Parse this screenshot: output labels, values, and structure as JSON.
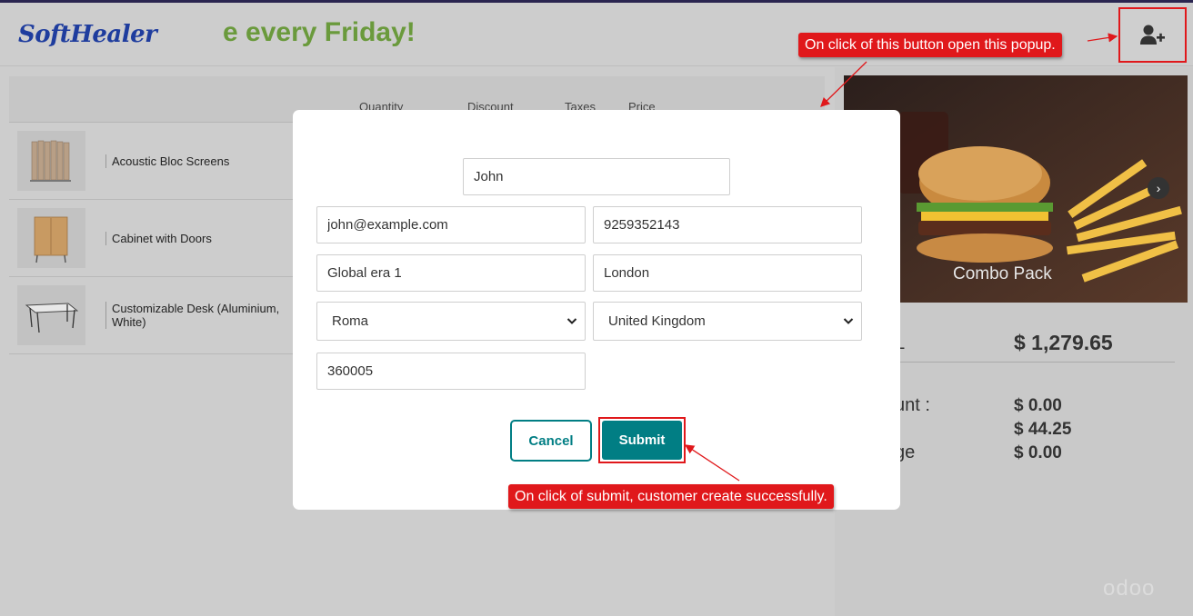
{
  "header": {
    "logo_text": "SoftHealer",
    "marquee_text": "e every Friday!",
    "add_customer_icon": "user-plus-icon"
  },
  "order_table": {
    "headers": {
      "quantity": "Quantity",
      "discount": "Discount",
      "taxes": "Taxes",
      "price": "Price"
    },
    "products": [
      {
        "name": "Acoustic Bloc Screens"
      },
      {
        "name": "Cabinet with Doors"
      },
      {
        "name": "Customizable Desk (Aluminium, White)"
      }
    ]
  },
  "promo": {
    "label": "Combo Pack",
    "next_icon": "chevron-right-icon"
  },
  "summary": {
    "total_label": "L",
    "total_value": "$ 1,279.65",
    "discount_label": "unt :",
    "discount_value": "$ 0.00",
    "tax_label": ":",
    "tax_value": "$ 44.25",
    "change_label": "ge",
    "change_value": "$ 0.00"
  },
  "watermark": "odoo",
  "popup": {
    "name": "John",
    "email": "john@example.com",
    "phone": "9259352143",
    "street": "Global era 1",
    "city": "London",
    "state": "Roma",
    "country": "United Kingdom",
    "zip": "360005",
    "cancel_label": "Cancel",
    "submit_label": "Submit"
  },
  "annotations": {
    "top": "On click of this button open this popup.",
    "bottom": "On click of submit, customer create successfully."
  },
  "colors": {
    "accent": "#017e84",
    "annotation": "#e0181b",
    "marquee": "#6a9a3c",
    "logo": "#1f3d9e"
  }
}
